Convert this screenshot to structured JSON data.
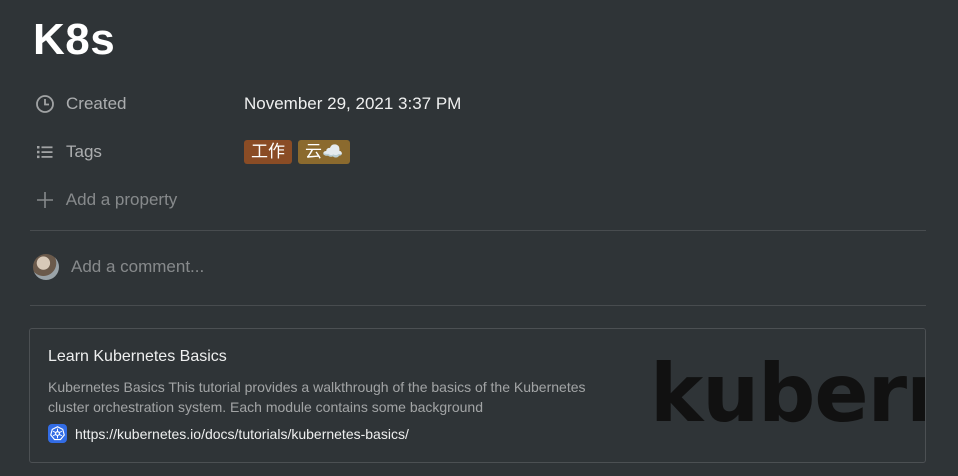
{
  "page": {
    "title": "K8s"
  },
  "properties": {
    "created": {
      "icon": "clock-icon",
      "label": "Created",
      "value": "November 29, 2021 3:37 PM"
    },
    "tags": {
      "icon": "list-icon",
      "label": "Tags",
      "values": [
        "工作",
        "云☁️"
      ],
      "colors": [
        "#8a4c25",
        "#8b6a2e"
      ]
    },
    "add_property": {
      "icon": "plus-icon",
      "label": "Add a property"
    }
  },
  "comment": {
    "placeholder": "Add a comment..."
  },
  "bookmark": {
    "title": "Learn Kubernetes Basics",
    "description": "Kubernetes Basics This tutorial provides a walkthrough of the basics of the Kubernetes cluster orchestration system. Each module contains some background",
    "url": "https://kubernetes.io/docs/tutorials/kubernetes-basics/",
    "favicon": "kubernetes-icon",
    "image_text": "kubernetes"
  },
  "colors": {
    "background": "#2f3437",
    "tag_work": "#8a4c25",
    "tag_cloud": "#8b6a2e",
    "k8s_blue": "#326ce5"
  }
}
